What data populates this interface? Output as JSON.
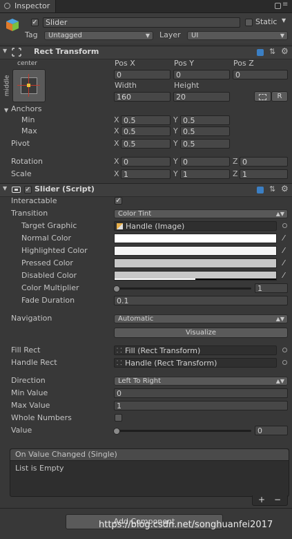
{
  "tab": {
    "title": "Inspector",
    "menu_icon": "lock-icon"
  },
  "object": {
    "active": true,
    "name": "Slider",
    "static_label": "Static",
    "static_checked": false,
    "tag_label": "Tag",
    "tag_value": "Untagged",
    "layer_label": "Layer",
    "layer_value": "UI"
  },
  "rect_transform": {
    "title": "Rect Transform",
    "anchor_h": "center",
    "anchor_v": "middle",
    "headers": [
      "Pos X",
      "Pos Y",
      "Pos Z"
    ],
    "values": [
      "0",
      "0",
      "0"
    ],
    "size_headers": [
      "Width",
      "Height"
    ],
    "size_values": [
      "160",
      "20"
    ],
    "r_button": "R",
    "anchors_label": "Anchors",
    "min_label": "Min",
    "max_label": "Max",
    "min": {
      "x": "0.5",
      "y": "0.5"
    },
    "max": {
      "x": "0.5",
      "y": "0.5"
    },
    "pivot_label": "Pivot",
    "pivot": {
      "x": "0.5",
      "y": "0.5"
    },
    "rotation_label": "Rotation",
    "rotation": {
      "x": "0",
      "y": "0",
      "z": "0"
    },
    "scale_label": "Scale",
    "scale": {
      "x": "1",
      "y": "1",
      "z": "1"
    },
    "axis": {
      "x": "X",
      "y": "Y",
      "z": "Z"
    }
  },
  "slider": {
    "title": "Slider (Script)",
    "enabled": true,
    "interactable_label": "Interactable",
    "interactable": true,
    "transition_label": "Transition",
    "transition_value": "Color Tint",
    "target_graphic_label": "Target Graphic",
    "target_graphic_value": "Handle (Image)",
    "normal_color_label": "Normal Color",
    "highlighted_color_label": "Highlighted Color",
    "pressed_color_label": "Pressed Color",
    "disabled_color_label": "Disabled Color",
    "normal_color": "#ffffff",
    "highlighted_color": "#f5f5f5",
    "pressed_color": "#c8c8c8",
    "disabled_color": "#c8c8c8",
    "color_multiplier_label": "Color Multiplier",
    "color_multiplier": "1",
    "fade_duration_label": "Fade Duration",
    "fade_duration": "0.1",
    "navigation_label": "Navigation",
    "navigation_value": "Automatic",
    "visualize_label": "Visualize",
    "fill_rect_label": "Fill Rect",
    "fill_rect_value": "Fill (Rect Transform)",
    "handle_rect_label": "Handle Rect",
    "handle_rect_value": "Handle (Rect Transform)",
    "direction_label": "Direction",
    "direction_value": "Left To Right",
    "min_value_label": "Min Value",
    "min_value": "0",
    "max_value_label": "Max Value",
    "max_value": "1",
    "whole_numbers_label": "Whole Numbers",
    "whole_numbers": false,
    "value_label": "Value",
    "value": "0"
  },
  "event": {
    "title": "On Value Changed (Single)",
    "empty_text": "List is Empty",
    "add": "+",
    "remove": "−"
  },
  "add_component_label": "Add Component",
  "watermark": "https://blog.csdn.net/songhuanfei2017"
}
